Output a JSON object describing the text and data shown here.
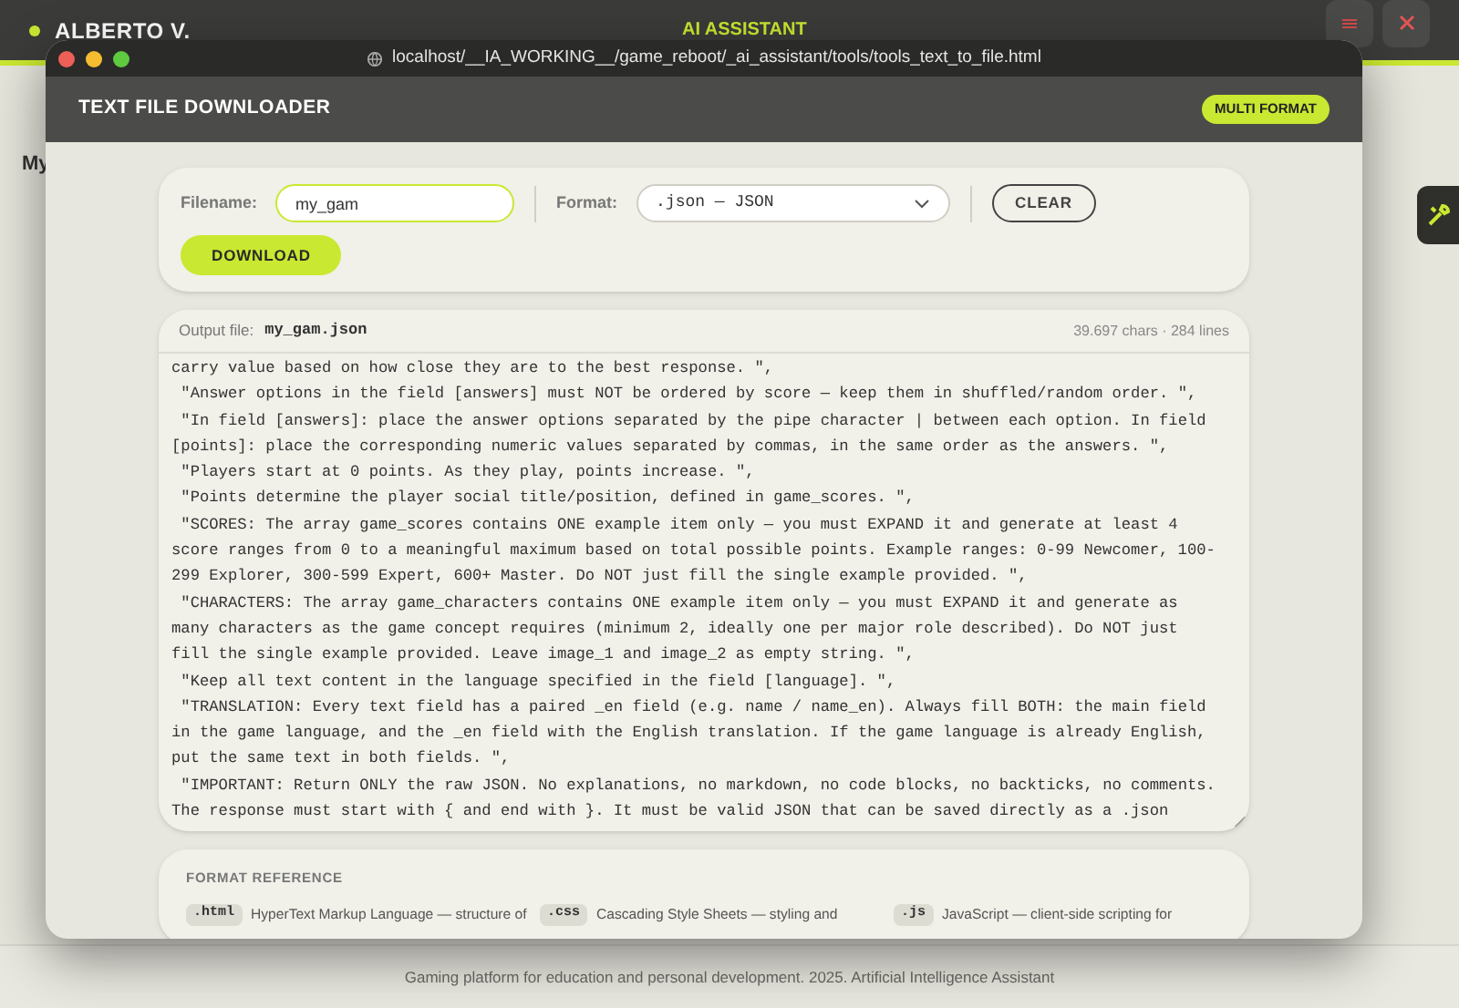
{
  "app_header": {
    "user": "ALBERTO V.",
    "title": "AI ASSISTANT"
  },
  "background_page": {
    "heading_fragment": "My"
  },
  "browser": {
    "url": "localhost/__IA_WORKING__/game_reboot/_ai_assistant/tools/tools_text_to_file.html"
  },
  "tool": {
    "title": "TEXT FILE DOWNLOADER",
    "badge": "MULTI FORMAT"
  },
  "form": {
    "filename_label": "Filename:",
    "filename_value": "my_gam",
    "format_label": "Format:",
    "format_value": ".json — JSON",
    "clear": "CLEAR",
    "download": "DOWNLOAD"
  },
  "output": {
    "label": "Output file:",
    "filename": "my_gam.json",
    "stats": "39.697 chars · 284 lines",
    "lines": [
      "carry value based on how close they are to the best response. \",",
      " \"Answer options in the field [answers] must NOT be ordered by score — keep them in shuffled/random order. \",",
      " \"In field [answers]: place the answer options separated by the pipe character | between each option. In field [points]: place the corresponding numeric values separated by commas, in the same order as the answers. \",",
      " \"Players start at 0 points. As they play, points increase. \",",
      " \"Points determine the player social title/position, defined in game_scores. \",",
      " \"SCORES: The array game_scores contains ONE example item only — you must EXPAND it and generate at least 4 score ranges from 0 to a meaningful maximum based on total possible points. Example ranges: 0-99 Newcomer, 100-299 Explorer, 300-599 Expert, 600+ Master. Do NOT just fill the single example provided. \",",
      " \"CHARACTERS: The array game_characters contains ONE example item only — you must EXPAND it and generate as many characters as the game concept requires (minimum 2, ideally one per major role described). Do NOT just fill the single example provided. Leave image_1 and image_2 as empty string. \",",
      " \"Keep all text content in the language specified in the field [language]. \",",
      " \"TRANSLATION: Every text field has a paired _en field (e.g. name / name_en). Always fill BOTH: the main field in the game language, and the _en field with the English translation. If the game language is already English, put the same text in both fields. \",",
      " \"IMPORTANT: Return ONLY the raw JSON. No explanations, no markdown, no code blocks, no backticks, no comments. The response must start with { and end with }. It must be valid JSON that can be saved directly as a .json"
    ]
  },
  "format_reference": {
    "title": "FORMAT REFERENCE",
    "items": [
      {
        "ext": ".html",
        "description": "HyperText Markup Language — structure of"
      },
      {
        "ext": ".css",
        "description": "Cascading Style Sheets — styling and"
      },
      {
        "ext": ".js",
        "description": "JavaScript — client-side scripting for"
      }
    ]
  },
  "footer": "Gaming platform for education and personal development. 2025. Artificial Intelligence Assistant"
}
